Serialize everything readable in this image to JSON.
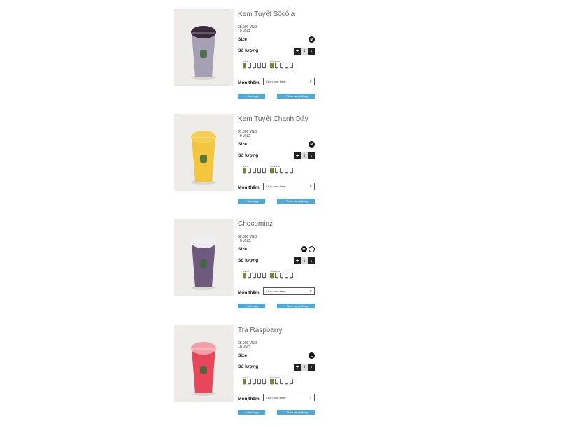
{
  "products": [
    {
      "name": "Kem Tuyết Sôcôla",
      "price": "38,000 VND",
      "surcharge": "+0 VND",
      "size_label": "Size",
      "sizes": [
        "M"
      ],
      "qty_label": "Số lượng",
      "qty": "1",
      "ice_label": "ICE %",
      "sugar_label": "SUGAR %",
      "topping_label": "Món thêm",
      "topping_placeholder": "Chọn món thêm",
      "buy_label": "➜ Mua Ngay",
      "cart_label": "✓ Thêm vào giỏ hàng",
      "drink_color": "#a6a0b4",
      "top_color": "#3b2a3c"
    },
    {
      "name": "Kem Tuyết Chanh Dây",
      "price": "31,000 VND",
      "surcharge": "+0 VND",
      "size_label": "Size",
      "sizes": [
        "M"
      ],
      "qty_label": "Số lượng",
      "qty": "1",
      "ice_label": "ICE %",
      "sugar_label": "SUGAR %",
      "topping_label": "Món thêm",
      "topping_placeholder": "Chọn món thêm",
      "buy_label": "➜ Mua Ngay",
      "cart_label": "✓ Thêm vào giỏ hàng",
      "drink_color": "#f3c63d",
      "top_color": "#f6cf52"
    },
    {
      "name": "Chocominz",
      "price": "38,000 VND",
      "surcharge": "+0 VND",
      "size_label": "Size",
      "sizes": [
        "M",
        "L"
      ],
      "qty_label": "Số lượng",
      "qty": "1",
      "ice_label": "ICE %",
      "sugar_label": "SUGAR %",
      "topping_label": "Món thêm",
      "topping_placeholder": "Chọn món thêm",
      "buy_label": "➜ Mua Ngay",
      "cart_label": "✓ Thêm vào giỏ hàng",
      "drink_color": "#6e5a7e",
      "top_color": "#efeef0"
    },
    {
      "name": "Trà Raspberry",
      "price": "38,000 VND",
      "surcharge": "+0 VND",
      "size_label": "Size",
      "sizes": [
        "L"
      ],
      "qty_label": "Số lượng",
      "qty": "1",
      "ice_label": "ICE %",
      "sugar_label": "SUGAR %",
      "topping_label": "Món thêm",
      "topping_placeholder": "Chọn món thêm",
      "buy_label": "➜ Mua Ngay",
      "cart_label": "✓ Thêm vào giỏ hàng",
      "drink_color": "#e8475a",
      "top_color": "#f2a0a8"
    }
  ],
  "cup_levels": [
    "100",
    "70",
    "50",
    "30",
    "10"
  ],
  "selected_level_index": 0,
  "colors": {
    "button": "#4fa9d6",
    "cup_selected": "#6b8a3a",
    "size_selected": "#111111"
  }
}
